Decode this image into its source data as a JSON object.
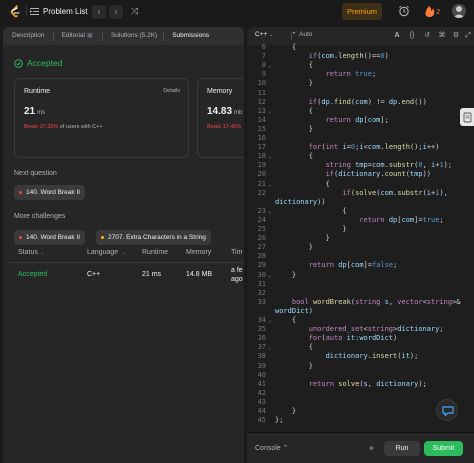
{
  "topbar": {
    "problem_list": "Problem List",
    "prev": "‹",
    "next": "›",
    "premium": "Premium",
    "streak_count": "2"
  },
  "tabs": [
    {
      "label": "Description"
    },
    {
      "label": "Editorial"
    },
    {
      "label": "Solutions (5.2K)"
    },
    {
      "label": "Submissions"
    }
  ],
  "result": {
    "status": "Accepted",
    "runtime_label": "Runtime",
    "details": "Details",
    "runtime_value": "21",
    "runtime_unit": "ms",
    "runtime_beats_pct": "Beats 37.33%",
    "runtime_beats_rest": " of users with C++",
    "memory_label": "Memory",
    "memory_value": "14.83",
    "memory_unit": "mb",
    "memory_beats_pct": "Beats 17.45%"
  },
  "next_question": {
    "label": "Next question",
    "item": "140. Word Break II"
  },
  "more_challenges": {
    "label": "More challenges",
    "items": [
      "140. Word Break II",
      "2707. Extra Characters in a String"
    ]
  },
  "submissions": {
    "headers": [
      "Status",
      "Language",
      "Runtime",
      "Memory",
      "Tim"
    ],
    "row": {
      "status": "Accepted",
      "language": "C++",
      "runtime": "21 ms",
      "memory": "14.8 MB",
      "time_1": "a fe",
      "time_2": "ago"
    }
  },
  "editor": {
    "language": "C++",
    "mode": "Auto",
    "lines": [
      {
        "n": "6",
        "t": "    {"
      },
      {
        "n": "7",
        "t": "        if(com.length()==0)"
      },
      {
        "n": "8",
        "t": "        {"
      },
      {
        "n": "9",
        "t": "            return true;"
      },
      {
        "n": "10",
        "t": "        }"
      },
      {
        "n": "11",
        "t": ""
      },
      {
        "n": "12",
        "t": "        if(dp.find(com) != dp.end())"
      },
      {
        "n": "13",
        "t": "        {"
      },
      {
        "n": "14",
        "t": "            return dp[com];"
      },
      {
        "n": "15",
        "t": "        }"
      },
      {
        "n": "16",
        "t": ""
      },
      {
        "n": "17",
        "t": "        for(int i=0;i<com.length();i++)"
      },
      {
        "n": "18",
        "t": "        {"
      },
      {
        "n": "19",
        "t": "            string tmp=com.substr(0, i+1);"
      },
      {
        "n": "20",
        "t": "            if(dictionary.count(tmp))"
      },
      {
        "n": "21",
        "t": "            {"
      },
      {
        "n": "22",
        "t": "                if(solve(com.substr(i+1),"
      },
      {
        "n": "",
        "t": "dictionary))"
      },
      {
        "n": "23",
        "t": "                {"
      },
      {
        "n": "24",
        "t": "                    return dp[com]=true;"
      },
      {
        "n": "25",
        "t": "                }"
      },
      {
        "n": "26",
        "t": "            }"
      },
      {
        "n": "27",
        "t": "        }"
      },
      {
        "n": "28",
        "t": ""
      },
      {
        "n": "29",
        "t": "        return dp[com]=false;"
      },
      {
        "n": "30",
        "t": "    }"
      },
      {
        "n": "31",
        "t": ""
      },
      {
        "n": "32",
        "t": ""
      },
      {
        "n": "33",
        "t": "    bool wordBreak(string s, vector<string>&"
      },
      {
        "n": "",
        "t": "wordDict)"
      },
      {
        "n": "34",
        "t": "    {"
      },
      {
        "n": "35",
        "t": "        unordered_set<string>dictionary;"
      },
      {
        "n": "36",
        "t": "        for(auto it:wordDict)"
      },
      {
        "n": "37",
        "t": "        {"
      },
      {
        "n": "38",
        "t": "            dictionary.insert(it);"
      },
      {
        "n": "39",
        "t": "        }"
      },
      {
        "n": "40",
        "t": ""
      },
      {
        "n": "41",
        "t": "        return solve(s, dictionary);"
      },
      {
        "n": "42",
        "t": ""
      },
      {
        "n": "43",
        "t": ""
      },
      {
        "n": "44",
        "t": "    }"
      },
      {
        "n": "45",
        "t": "};"
      }
    ]
  },
  "console": {
    "label": "Console ⌃",
    "run": "Run",
    "submit": "Submit"
  },
  "colors": {
    "accent": "#ffa116",
    "success": "#2cbb5d",
    "danger": "#ef4743"
  }
}
